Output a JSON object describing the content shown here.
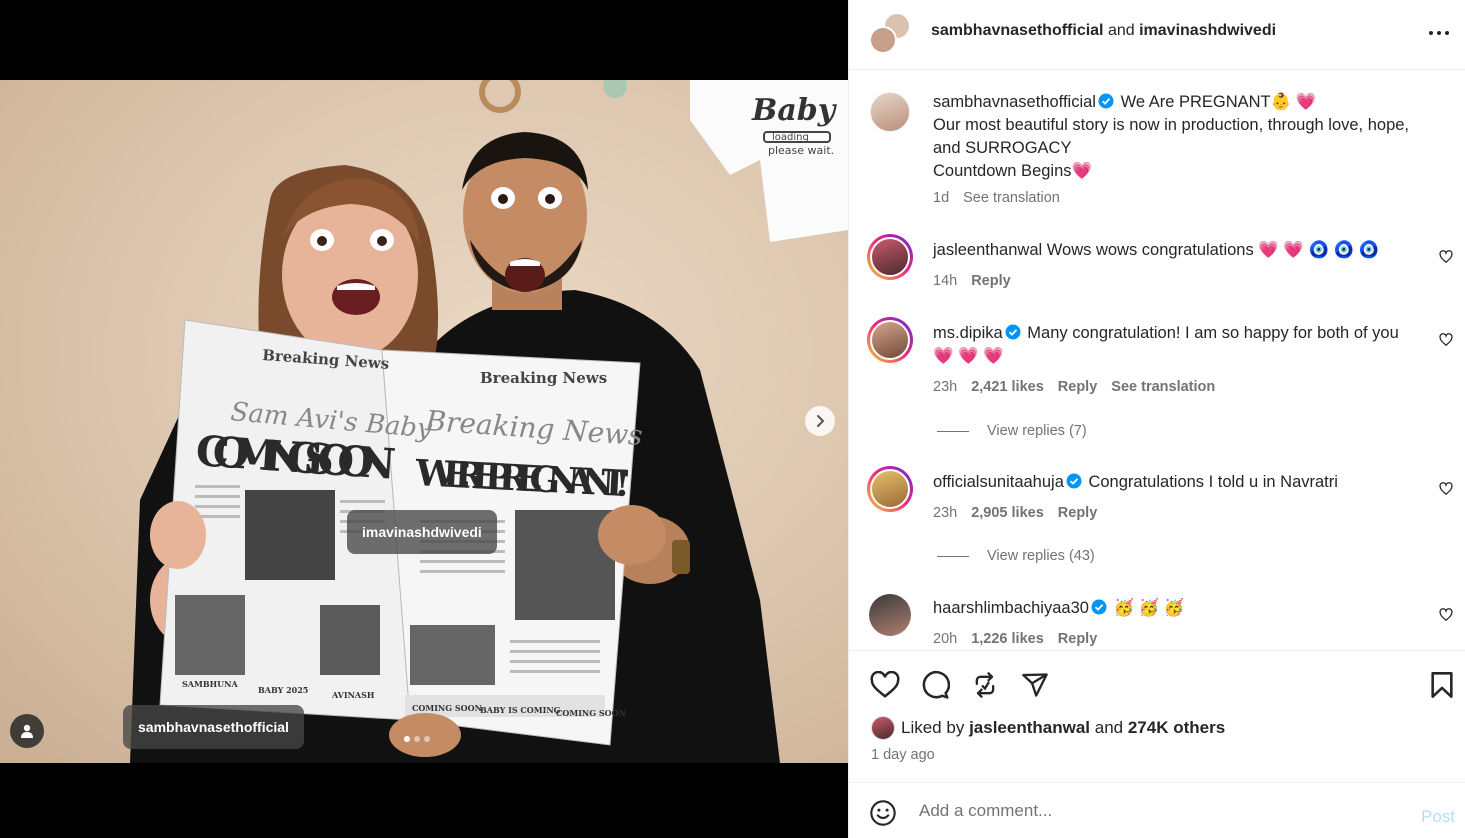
{
  "media": {
    "tags": {
      "avinash": "imavinashdwivedi",
      "sambhavna": "sambhavnasethofficial"
    },
    "newspaper": {
      "masthead": "Breaking News",
      "headline_left": "COMING SOON",
      "script_left": "Sam Avi's Baby",
      "script_right": "Breaking News",
      "headline_right": "WE'RE PREGNANT!",
      "footer_left": "COMING SOON",
      "footer_mid": "BABY IS COMING",
      "footer_right": "COMING SOON",
      "bottom_left": "SAMBHUNA",
      "bottom_mid": "BABY 2025",
      "bottom_right": "AVINASH"
    },
    "shirt_text": "Baby loading please wait",
    "carousel": {
      "total": 3,
      "active": 1
    }
  },
  "header": {
    "user1": "sambhavnasethofficial",
    "joiner": "and",
    "user2": "imavinashdwivedi"
  },
  "caption": {
    "user": "sambhavnasethofficial",
    "line1": "We Are PREGNANT👶 💗",
    "line2": "Our most beautiful story is now in production, through love, hope, and SURROGACY",
    "line3": "Countdown Begins💗",
    "time": "1d",
    "see_translation": "See translation"
  },
  "comments": [
    {
      "user": "jasleenthanwal",
      "verified": false,
      "text": "Wows wows congratulations 💗 💗 🧿 🧿 🧿",
      "time": "14h",
      "likes": "",
      "reply": "Reply",
      "translation": "",
      "replies": ""
    },
    {
      "user": "ms.dipika",
      "verified": true,
      "text": "Many congratulation! I am so happy for both of you 💗 💗 💗",
      "time": "23h",
      "likes": "2,421 likes",
      "reply": "Reply",
      "translation": "See translation",
      "replies": "View replies (7)"
    },
    {
      "user": "officialsunitaahuja",
      "verified": true,
      "text": "Congratulations I told u in Navratri",
      "time": "23h",
      "likes": "2,905 likes",
      "reply": "Reply",
      "translation": "",
      "replies": "View replies (43)"
    },
    {
      "user": "haarshlimbachiyaa30",
      "verified": true,
      "text": "🥳 🥳 🥳",
      "time": "20h",
      "likes": "1,226 likes",
      "reply": "Reply",
      "translation": "",
      "replies": ""
    }
  ],
  "likes": {
    "prefix": "Liked by",
    "user": "jasleenthanwal",
    "joiner": "and",
    "others": "274K others",
    "time_ago": "1 day ago"
  },
  "add_comment": {
    "placeholder": "Add a comment...",
    "post": "Post"
  },
  "colors": {
    "verified": "#0095f6",
    "heart": "#ff3b6b",
    "post_disabled": "#b2dffc",
    "muted": "#737373"
  }
}
